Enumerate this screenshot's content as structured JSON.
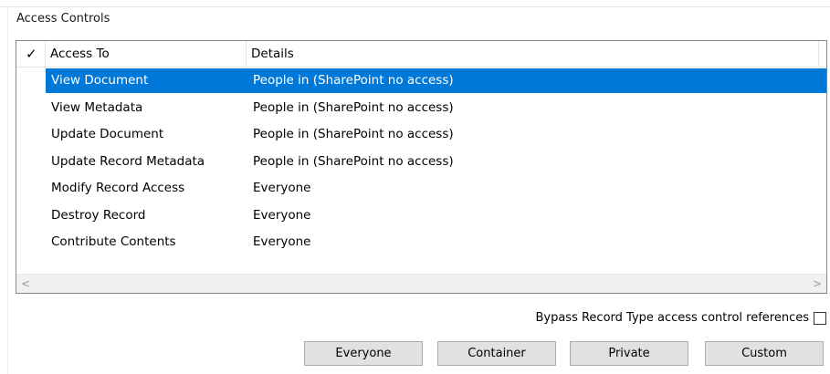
{
  "group": {
    "title": "Access Controls"
  },
  "table": {
    "columns": {
      "check": "✓",
      "access_to": "Access To",
      "details": "Details"
    },
    "rows": [
      {
        "access_to": "View Document",
        "details": "People in (SharePoint no access)",
        "selected": true
      },
      {
        "access_to": "View Metadata",
        "details": "People in (SharePoint no access)",
        "selected": false
      },
      {
        "access_to": "Update Document",
        "details": "People in (SharePoint no access)",
        "selected": false
      },
      {
        "access_to": "Update Record Metadata",
        "details": "People in (SharePoint no access)",
        "selected": false
      },
      {
        "access_to": "Modify Record Access",
        "details": "Everyone",
        "selected": false
      },
      {
        "access_to": "Destroy Record",
        "details": "Everyone",
        "selected": false
      },
      {
        "access_to": "Contribute Contents",
        "details": "Everyone",
        "selected": false
      }
    ],
    "scroll_left_icon": "chevron-left-icon",
    "scroll_right_icon": "chevron-right-icon",
    "scroll_left_glyph": "<",
    "scroll_right_glyph": ">"
  },
  "bypass": {
    "label": "Bypass Record Type access control references",
    "checked": false
  },
  "buttons": {
    "everyone": "Everyone",
    "container": "Container",
    "private": "Private",
    "custom": "Custom"
  },
  "colors": {
    "selection": "#0078d7",
    "button_face": "#e1e1e1",
    "border": "#828790"
  }
}
